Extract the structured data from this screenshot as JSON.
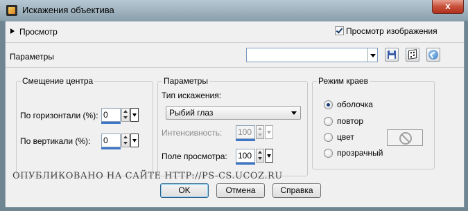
{
  "window": {
    "title": "Искажения объектива",
    "close_symbol": "x"
  },
  "preview": {
    "section_label": "Просмотр",
    "checkbox_label": "Просмотр изображения",
    "checkbox_checked": true
  },
  "presets": {
    "label": "Параметры",
    "value": ""
  },
  "center_offset": {
    "title": "Смещение центра",
    "horizontal_label": "По горизонтали (%):",
    "horizontal_value": "0",
    "vertical_label": "По вертикали (%):",
    "vertical_value": "0"
  },
  "parameters": {
    "title": "Параметры",
    "distortion_type_label": "Тип искажения:",
    "distortion_type_value": "Рыбий глаз",
    "intensity_label": "Интенсивность:",
    "intensity_value": "100",
    "intensity_enabled": false,
    "fov_label": "Поле просмотра:",
    "fov_value": "100"
  },
  "edge_mode": {
    "title": "Режим краев",
    "options": [
      "оболочка",
      "повтор",
      "цвет",
      "прозрачный"
    ],
    "selected": "оболочка"
  },
  "watermark": "ОПУБЛИКОВАНО  НА САЙТЕ  HTTP://PS-CS.UCOZ.RU",
  "buttons": {
    "ok": "OK",
    "cancel": "Отмена",
    "help": "Справка"
  }
}
